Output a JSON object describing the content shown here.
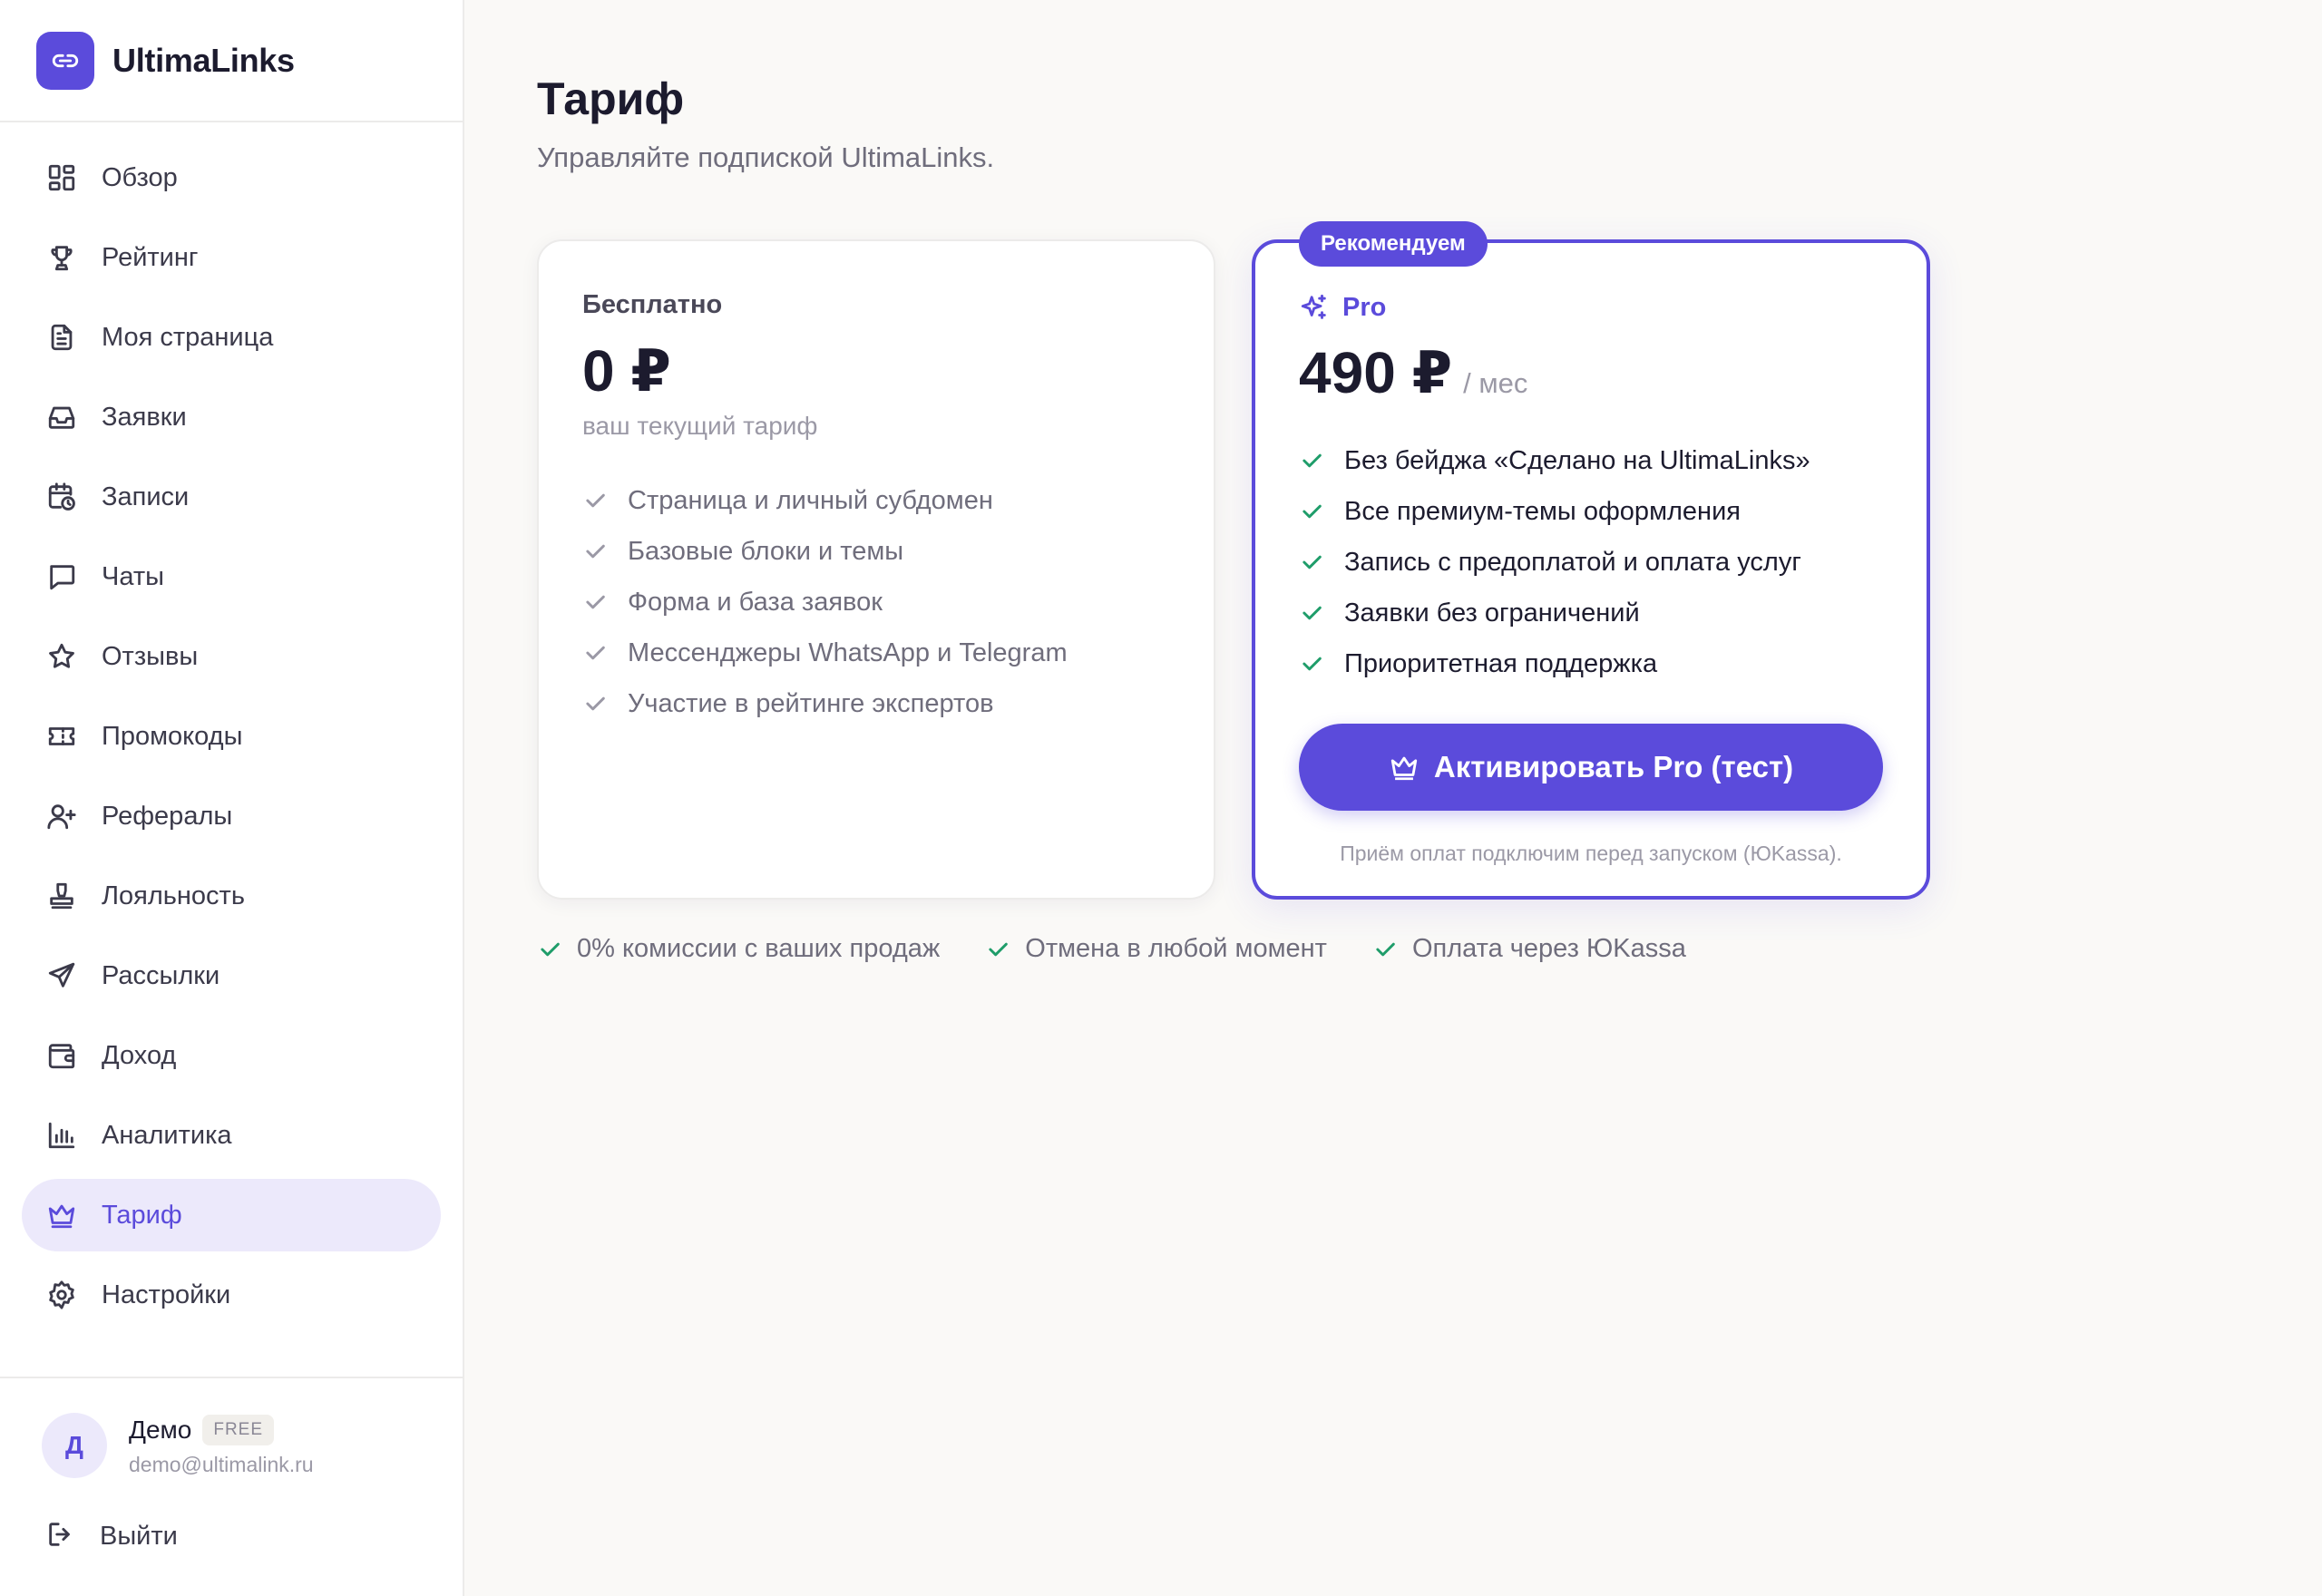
{
  "brand": {
    "name": "UltimaLinks",
    "logo_icon": "link-icon"
  },
  "sidebar": {
    "items": [
      {
        "label": "Обзор",
        "icon": "grid-icon",
        "active": false
      },
      {
        "label": "Рейтинг",
        "icon": "trophy-icon",
        "active": false
      },
      {
        "label": "Моя страница",
        "icon": "file-icon",
        "active": false
      },
      {
        "label": "Заявки",
        "icon": "inbox-icon",
        "active": false
      },
      {
        "label": "Записи",
        "icon": "calendar-clock-icon",
        "active": false
      },
      {
        "label": "Чаты",
        "icon": "chat-icon",
        "active": false
      },
      {
        "label": "Отзывы",
        "icon": "star-icon",
        "active": false
      },
      {
        "label": "Промокоды",
        "icon": "ticket-icon",
        "active": false
      },
      {
        "label": "Рефералы",
        "icon": "user-plus-icon",
        "active": false
      },
      {
        "label": "Лояльность",
        "icon": "stamp-icon",
        "active": false
      },
      {
        "label": "Рассылки",
        "icon": "send-icon",
        "active": false
      },
      {
        "label": "Доход",
        "icon": "wallet-icon",
        "active": false
      },
      {
        "label": "Аналитика",
        "icon": "bar-chart-icon",
        "active": false
      },
      {
        "label": "Тариф",
        "icon": "crown-icon",
        "active": true
      },
      {
        "label": "Настройки",
        "icon": "gear-icon",
        "active": false
      }
    ],
    "user": {
      "initial": "Д",
      "name": "Демо",
      "plan": "FREE",
      "email": "demo@ultimalink.ru"
    },
    "logout_label": "Выйти"
  },
  "main": {
    "title": "Тариф",
    "subtitle": "Управляйте подпиской UltimaLinks.",
    "free_plan": {
      "name": "Бесплатно",
      "price": "0 ₽",
      "note": "ваш текущий тариф",
      "features": [
        "Страница и личный субдомен",
        "Базовые блоки и темы",
        "Форма и база заявок",
        "Мессенджеры WhatsApp и Telegram",
        "Участие в рейтинге экспертов"
      ]
    },
    "pro_plan": {
      "badge": "Рекомендуем",
      "name": "Pro",
      "price": "490 ₽",
      "period": "/ мес",
      "features": [
        "Без бейджа «Сделано на UltimaLinks»",
        "Все премиум-темы оформления",
        "Запись с предоплатой и оплата услуг",
        "Заявки без ограничений",
        "Приоритетная поддержка"
      ],
      "button_label": "Активировать Pro (тест)",
      "payment_note": "Приём оплат подключим перед запуском (ЮKassa)."
    },
    "perks": [
      "0% комиссии с ваших продаж",
      "Отмена в любой момент",
      "Оплата через ЮKassa"
    ]
  },
  "colors": {
    "accent": "#5b4bdb",
    "accent_soft": "#ece9fb",
    "check_green": "#1f9d6a",
    "background": "#faf9f7"
  }
}
